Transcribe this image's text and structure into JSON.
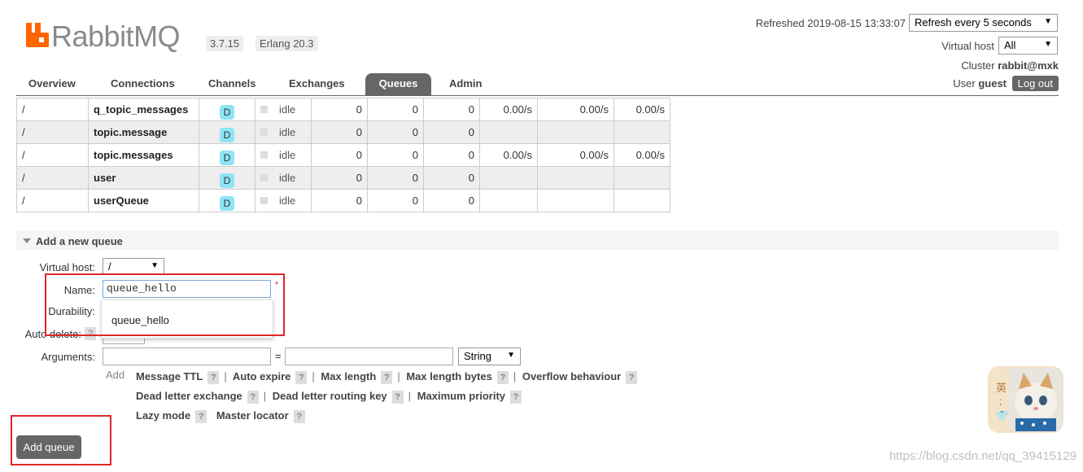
{
  "app": {
    "name": "RabbitMQ",
    "version": "3.7.15",
    "erlang": "Erlang 20.3"
  },
  "header": {
    "refreshed": "Refreshed 2019-08-15 13:33:07",
    "refresh_option": "Refresh every 5 seconds",
    "vhost_label": "Virtual host",
    "vhost_value": "All",
    "cluster_label": "Cluster",
    "cluster_value": "rabbit@mxk",
    "user_label": "User",
    "user_value": "guest",
    "logout": "Log out"
  },
  "tabs": [
    "Overview",
    "Connections",
    "Channels",
    "Exchanges",
    "Queues",
    "Admin"
  ],
  "active_tab": "Queues",
  "queues": [
    {
      "vhost": "/",
      "name": "q_topic_messages",
      "feature": "D",
      "state": "idle",
      "ready": "0",
      "unacked": "0",
      "total": "0",
      "incoming": "0.00/s",
      "deliver": "0.00/s",
      "ack": "0.00/s"
    },
    {
      "vhost": "/",
      "name": "topic.message",
      "feature": "D",
      "state": "idle",
      "ready": "0",
      "unacked": "0",
      "total": "0",
      "incoming": "",
      "deliver": "",
      "ack": ""
    },
    {
      "vhost": "/",
      "name": "topic.messages",
      "feature": "D",
      "state": "idle",
      "ready": "0",
      "unacked": "0",
      "total": "0",
      "incoming": "0.00/s",
      "deliver": "0.00/s",
      "ack": "0.00/s"
    },
    {
      "vhost": "/",
      "name": "user",
      "feature": "D",
      "state": "idle",
      "ready": "0",
      "unacked": "0",
      "total": "0",
      "incoming": "",
      "deliver": "",
      "ack": ""
    },
    {
      "vhost": "/",
      "name": "userQueue",
      "feature": "D",
      "state": "idle",
      "ready": "0",
      "unacked": "0",
      "total": "0",
      "incoming": "",
      "deliver": "",
      "ack": ""
    }
  ],
  "add_queue": {
    "section_title": "Add a new queue",
    "vhost_label": "Virtual host:",
    "vhost_value": "/",
    "name_label": "Name:",
    "name_value": "queue_hello",
    "required_mark": "*",
    "autocomplete": "queue_hello",
    "durability_label": "Durability:",
    "autodelete_label": "Auto delete:",
    "arguments_label": "Arguments:",
    "equals": "=",
    "type_value": "String",
    "add_label": "Add",
    "help_mark": "?",
    "arg_links": [
      "Message TTL",
      "Auto expire",
      "Max length",
      "Max length bytes",
      "Overflow behaviour",
      "Dead letter exchange",
      "Dead letter routing key",
      "Maximum priority",
      "Lazy mode",
      "Master locator"
    ],
    "separator": "|",
    "submit": "Add queue"
  },
  "watermark": "https://blog.csdn.net/qq_39415129",
  "ime_char": "英"
}
